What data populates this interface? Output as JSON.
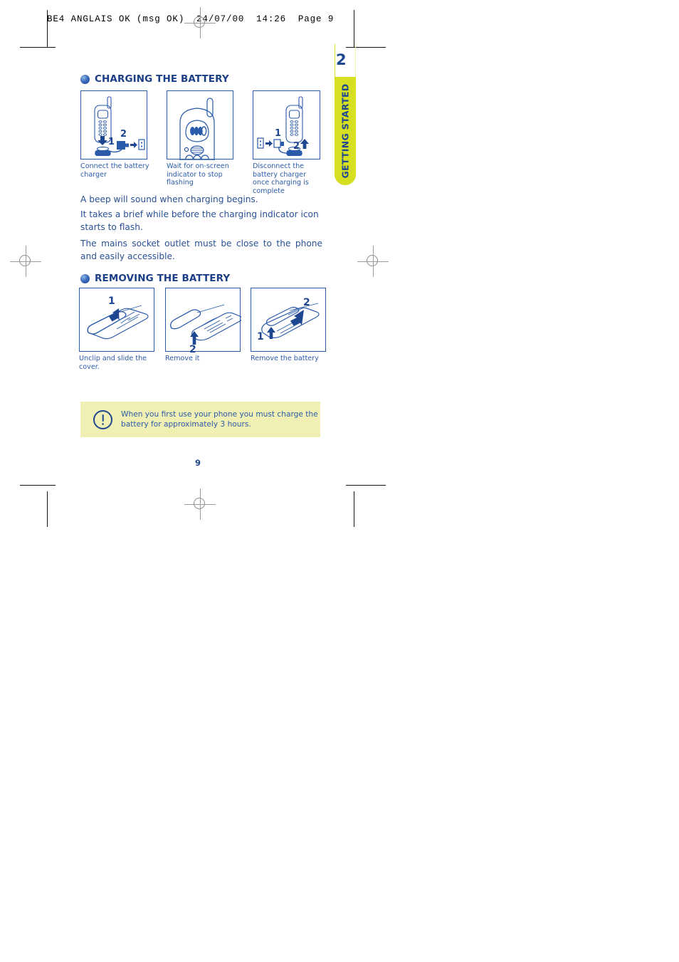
{
  "printer_slug": "BE4 ANGLAIS OK (msg OK)  24/07/00  14:26  Page 9",
  "chapter": {
    "number": "2",
    "tab_label": "GETTING STARTED",
    "tab_color": "#d6e020",
    "text_color": "#1f4690"
  },
  "sections": [
    {
      "heading": "CHARGING THE BATTERY",
      "figures": [
        {
          "caption": "Connect the battery charger",
          "step_labels": [
            "1",
            "2"
          ]
        },
        {
          "caption": "Wait for on-screen indicator to stop flashing",
          "step_labels": []
        },
        {
          "caption": "Disconnect the battery charger once charging is complete",
          "step_labels": [
            "1",
            "2"
          ]
        }
      ]
    },
    {
      "heading": "REMOVING THE BATTERY",
      "figures": [
        {
          "caption": "Unclip and slide the cover.",
          "step_labels": [
            "1"
          ]
        },
        {
          "caption": "Remove it",
          "step_labels": [
            "2"
          ]
        },
        {
          "caption": "Remove the battery",
          "step_labels": [
            "1",
            "2"
          ]
        }
      ]
    }
  ],
  "paragraphs": [
    "A beep will sound when charging begins.",
    "It takes a brief while before the charging indicator icon starts to flash.",
    "The mains socket outlet must be close to the phone and easily accessible."
  ],
  "note": {
    "icon": "exclamation-circle-icon",
    "text": "When you first use your phone you must charge the battery for approximately 3 hours.",
    "background": "#f0f0b4"
  },
  "page_number": "9",
  "colors": {
    "ink_blue": "#1f4690",
    "line_blue": "#2a5bab",
    "caption_blue": "#2d5ba8"
  }
}
